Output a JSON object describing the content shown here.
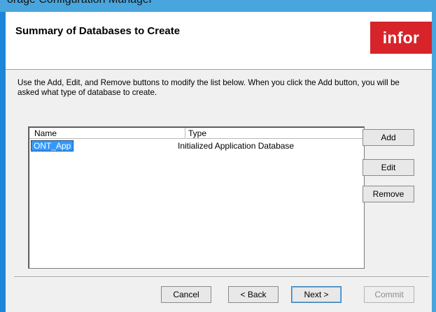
{
  "background_window": {
    "title_fragment": "orage Configuration Manager"
  },
  "wizard": {
    "title": "Summary of Databases to Create",
    "logo_text": "infor",
    "instructions": "Use the Add, Edit, and Remove buttons to modify the list below.  When you click the Add button, you will be asked what type of database to create.",
    "list": {
      "columns": [
        "Name",
        "Type"
      ],
      "rows": [
        {
          "name": "ONT_App",
          "type": "Initialized Application Database",
          "selected": true
        }
      ]
    },
    "side_buttons": {
      "add": "Add",
      "edit": "Edit",
      "remove": "Remove"
    },
    "bottom_buttons": {
      "cancel": "Cancel",
      "back": "< Back",
      "next": "Next >",
      "commit": "Commit"
    }
  },
  "colors": {
    "brand_logo": "#d6242a",
    "selection": "#3399ff",
    "window_frame": "#1c86d8"
  }
}
